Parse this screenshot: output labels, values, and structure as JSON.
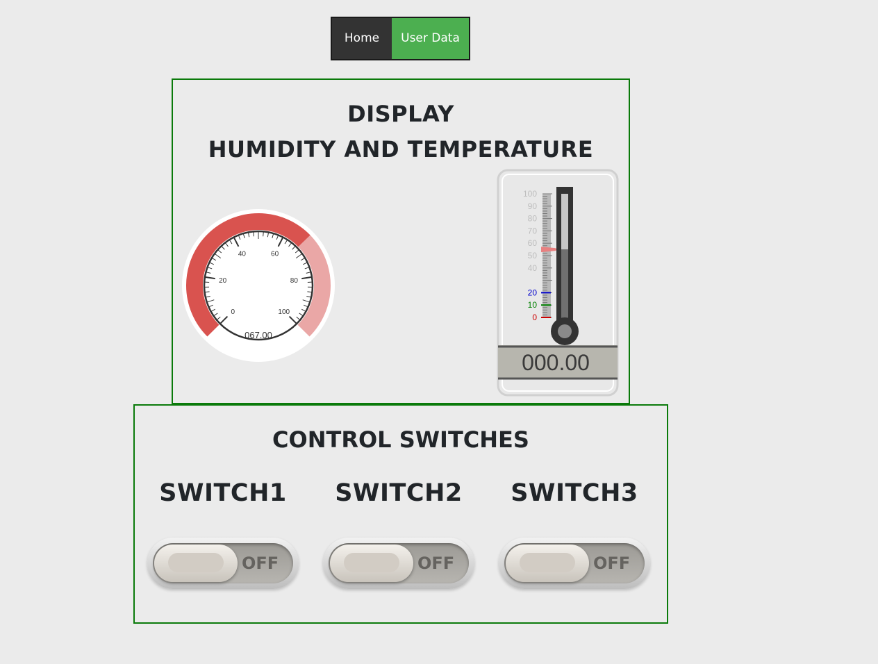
{
  "nav": {
    "home_label": "Home",
    "user_data_label": "User Data",
    "active_color": "#4caf50"
  },
  "display": {
    "title": "DISPLAY",
    "subtitle": "HUMIDITY AND TEMPERATURE",
    "humidity_gauge": {
      "value_text": "067.00",
      "value": 67,
      "min": 0,
      "max": 100,
      "tick_labels": [
        "0",
        "20",
        "40",
        "60",
        "80",
        "100"
      ],
      "arc_color_dark": "#d9534f",
      "arc_color_light": "#eaa7a6"
    },
    "thermometer": {
      "value_text": "000.00",
      "scale_labels": [
        "100",
        "90",
        "80",
        "70",
        "60",
        "50",
        "40",
        "20",
        "10",
        "0"
      ],
      "marker_value": 55,
      "label_colors": {
        "20": "#0000cc",
        "10": "#008000",
        "0": "#cc0000"
      }
    }
  },
  "controls": {
    "title": "CONTROL SWITCHES",
    "switches": [
      {
        "label": "SWITCH1",
        "state": "OFF"
      },
      {
        "label": "SWITCH2",
        "state": "OFF"
      },
      {
        "label": "SWITCH3",
        "state": "OFF"
      }
    ]
  }
}
